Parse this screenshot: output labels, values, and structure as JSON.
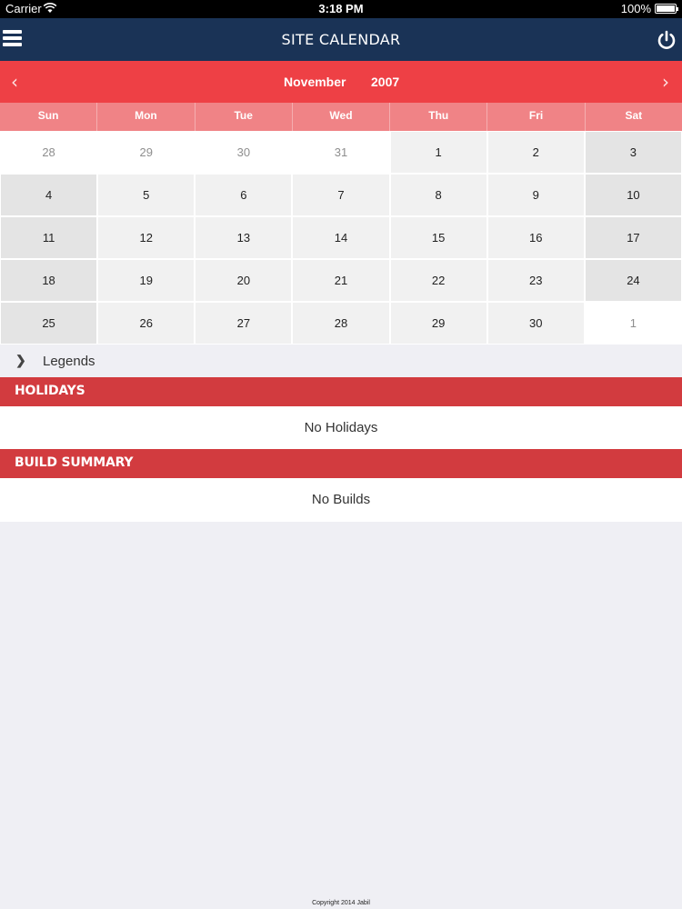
{
  "status": {
    "carrier": "Carrier",
    "time": "3:18 PM",
    "battery": "100%"
  },
  "nav": {
    "title": "SITE CALENDAR",
    "menu_icon": "hamburger-menu-icon",
    "power_icon": "power-icon"
  },
  "calendar": {
    "month": "November",
    "year": "2007",
    "prev_icon": "chevron-left-icon",
    "next_icon": "chevron-right-icon",
    "weekdays": [
      "Sun",
      "Mon",
      "Tue",
      "Wed",
      "Thu",
      "Fri",
      "Sat"
    ],
    "weeks": [
      [
        "28",
        "29",
        "30",
        "31",
        "1",
        "2",
        "3"
      ],
      [
        "4",
        "5",
        "6",
        "7",
        "8",
        "9",
        "10"
      ],
      [
        "11",
        "12",
        "13",
        "14",
        "15",
        "16",
        "17"
      ],
      [
        "18",
        "19",
        "20",
        "21",
        "22",
        "23",
        "24"
      ],
      [
        "25",
        "26",
        "27",
        "28",
        "29",
        "30",
        "1"
      ]
    ]
  },
  "legends": {
    "label": "Legends",
    "icon": "chevron-right-icon"
  },
  "holidays": {
    "header": "HOLIDAYS",
    "empty_text": "No Holidays"
  },
  "builds": {
    "header": "BUILD SUMMARY",
    "empty_text": "No Builds"
  },
  "footer": {
    "copyright": "Copyright 2014 Jabil"
  },
  "colors": {
    "nav": "#1a3356",
    "month_bar": "#ee4045",
    "weekday_bar": "#f08386",
    "section_header": "#d23b3f"
  }
}
